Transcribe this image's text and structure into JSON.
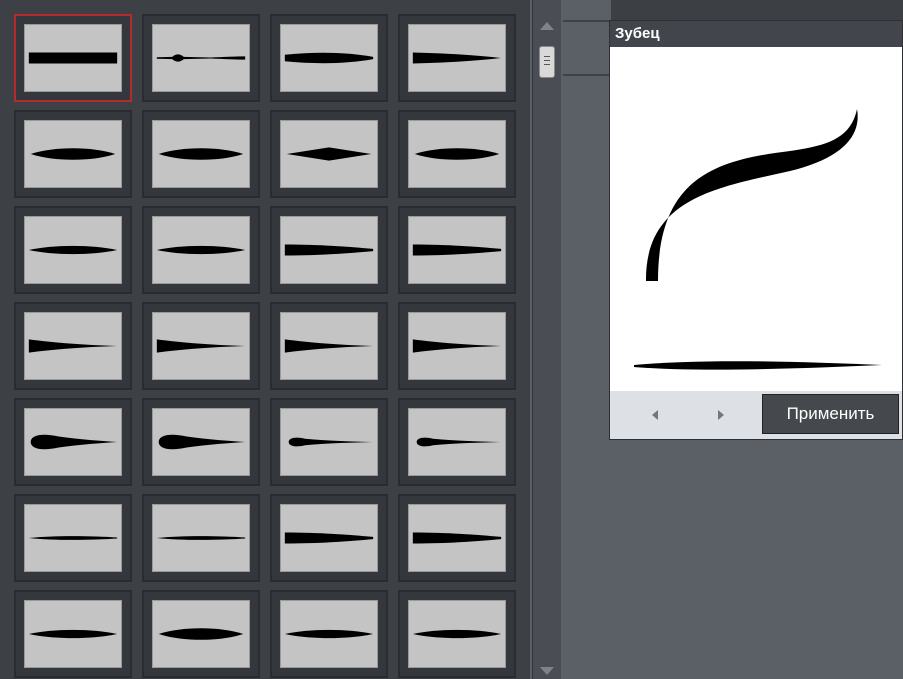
{
  "grid": {
    "selected_index": 0,
    "tiles": [
      {
        "name": "brush-preset-1",
        "shape": "uniform"
      },
      {
        "name": "brush-preset-2",
        "shape": "beaded"
      },
      {
        "name": "brush-preset-3",
        "shape": "long-taper"
      },
      {
        "name": "brush-preset-4",
        "shape": "right-taper"
      },
      {
        "name": "brush-preset-5",
        "shape": "ellipse"
      },
      {
        "name": "brush-preset-6",
        "shape": "ellipse"
      },
      {
        "name": "brush-preset-7",
        "shape": "diamond"
      },
      {
        "name": "brush-preset-8",
        "shape": "ellipse"
      },
      {
        "name": "brush-preset-9",
        "shape": "thin-ellipse"
      },
      {
        "name": "brush-preset-10",
        "shape": "thin-ellipse"
      },
      {
        "name": "brush-preset-11",
        "shape": "wedge"
      },
      {
        "name": "brush-preset-12",
        "shape": "wedge"
      },
      {
        "name": "brush-preset-13",
        "shape": "sharp-wedge"
      },
      {
        "name": "brush-preset-14",
        "shape": "sharp-wedge"
      },
      {
        "name": "brush-preset-15",
        "shape": "sharp-wedge"
      },
      {
        "name": "brush-preset-16",
        "shape": "sharp-wedge"
      },
      {
        "name": "brush-preset-17",
        "shape": "teardrop"
      },
      {
        "name": "brush-preset-18",
        "shape": "teardrop"
      },
      {
        "name": "brush-preset-19",
        "shape": "small-teardrop"
      },
      {
        "name": "brush-preset-20",
        "shape": "small-teardrop"
      },
      {
        "name": "brush-preset-21",
        "shape": "thin-line"
      },
      {
        "name": "brush-preset-22",
        "shape": "thin-line"
      },
      {
        "name": "brush-preset-23",
        "shape": "wedge"
      },
      {
        "name": "brush-preset-24",
        "shape": "wedge"
      },
      {
        "name": "brush-preset-25",
        "shape": "thin-ellipse"
      },
      {
        "name": "brush-preset-26",
        "shape": "ellipse"
      },
      {
        "name": "brush-preset-27",
        "shape": "thin-ellipse"
      },
      {
        "name": "brush-preset-28",
        "shape": "thin-ellipse"
      }
    ]
  },
  "preview": {
    "title": "Зубец",
    "apply_label": "Применить",
    "prev_icon": "chevron-left-icon",
    "next_icon": "chevron-right-icon"
  },
  "colors": {
    "selected_border": "#b52a2a",
    "tile_bg": "#c4c4c4",
    "stroke": "#000000"
  }
}
